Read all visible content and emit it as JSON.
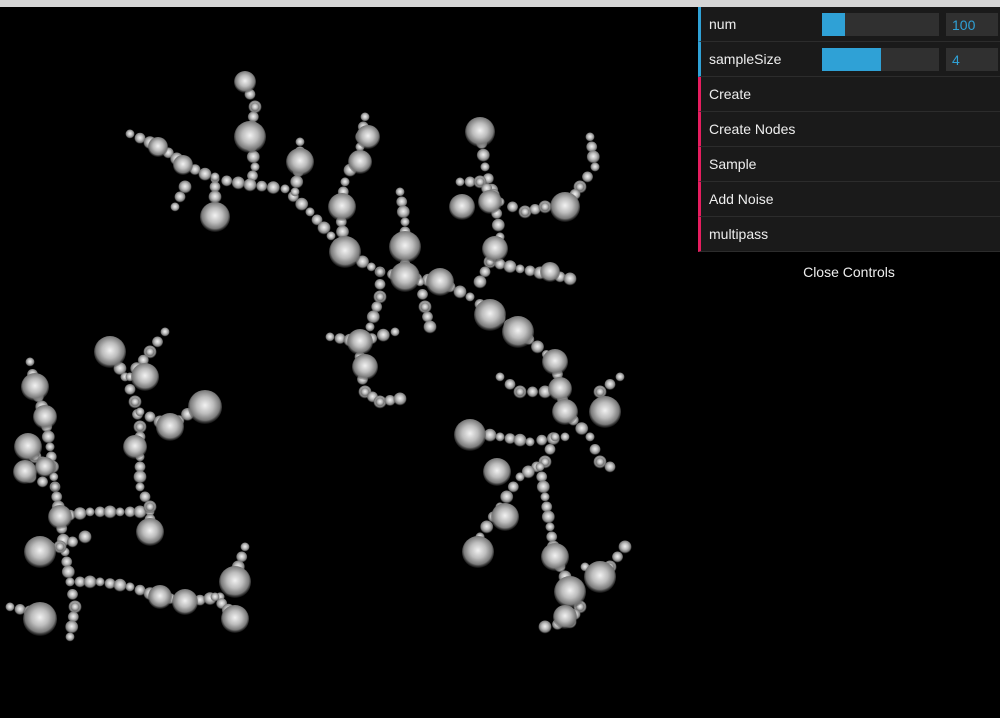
{
  "controls": {
    "num": {
      "label": "num",
      "value": "100",
      "fill": 0.2
    },
    "sampleSize": {
      "label": "sampleSize",
      "value": "4",
      "fill": 0.5
    },
    "create": "Create",
    "create_nodes": "Create Nodes",
    "sample": "Sample",
    "add_noise": "Add Noise",
    "multipass": "multipass",
    "close": "Close Controls"
  },
  "colors": {
    "background": "#000000",
    "number_accent": "#2fa1d6",
    "function_accent": "#e61d5f",
    "panel": "#1a1a1a"
  }
}
